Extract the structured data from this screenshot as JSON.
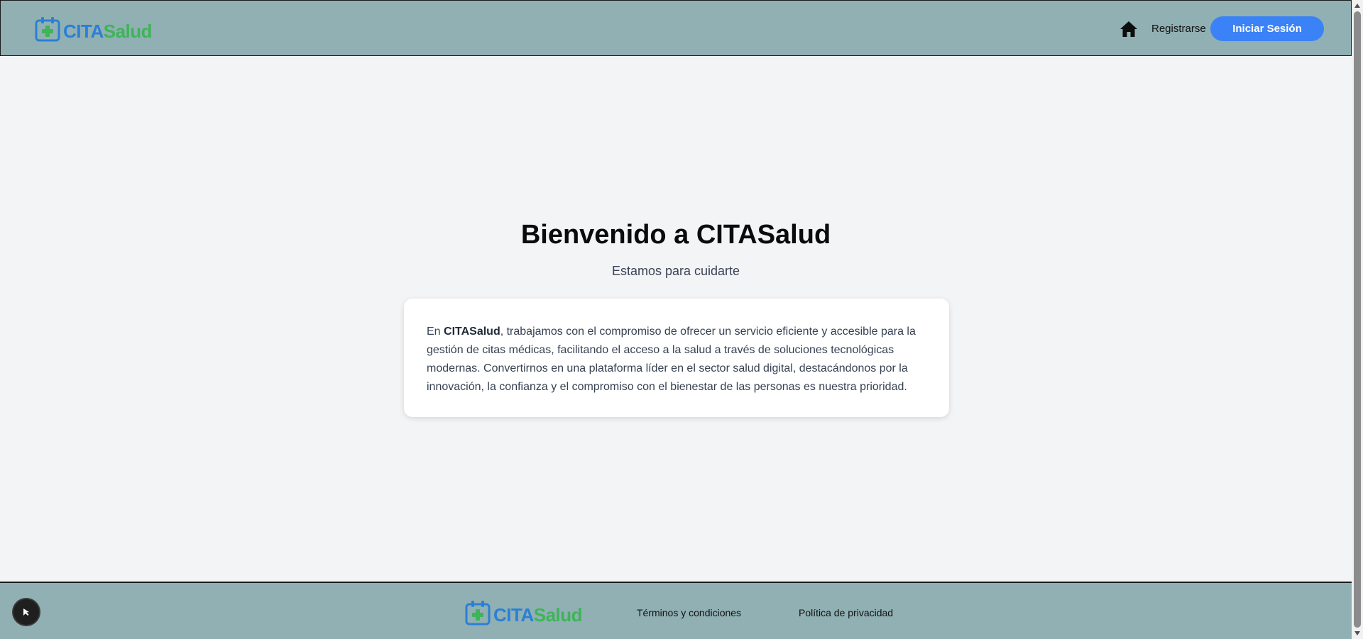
{
  "header": {
    "logo": {
      "part1": "CITA",
      "part2": "Salud"
    },
    "nav": {
      "home_icon": "home-icon",
      "register_label": "Registrarse",
      "login_label": "Iniciar Sesión"
    }
  },
  "main": {
    "title": "Bienvenido a CITASalud",
    "subtitle": "Estamos para cuidarte",
    "card": {
      "intro": "En ",
      "brand": "CITASalud",
      "body": ", trabajamos con el compromiso de ofrecer un servicio eficiente y accesible para la gestión de citas médicas, facilitando el acceso a la salud a través de soluciones tecnológicas modernas. Convertirnos en una plataforma líder en el sector salud digital, destacándonos por la innovación, la confianza y el compromiso con el bienestar de las personas es nuestra prioridad."
    }
  },
  "footer": {
    "logo": {
      "part1": "CITA",
      "part2": "Salud"
    },
    "terms_label": "Términos y condiciones",
    "privacy_label": "Política de privacidad"
  },
  "colors": {
    "header_bg": "#90b0b3",
    "logo_blue": "#2b7fd6",
    "logo_green": "#3fb458",
    "button_blue": "#3b82f6",
    "page_bg": "#f3f4f6"
  }
}
